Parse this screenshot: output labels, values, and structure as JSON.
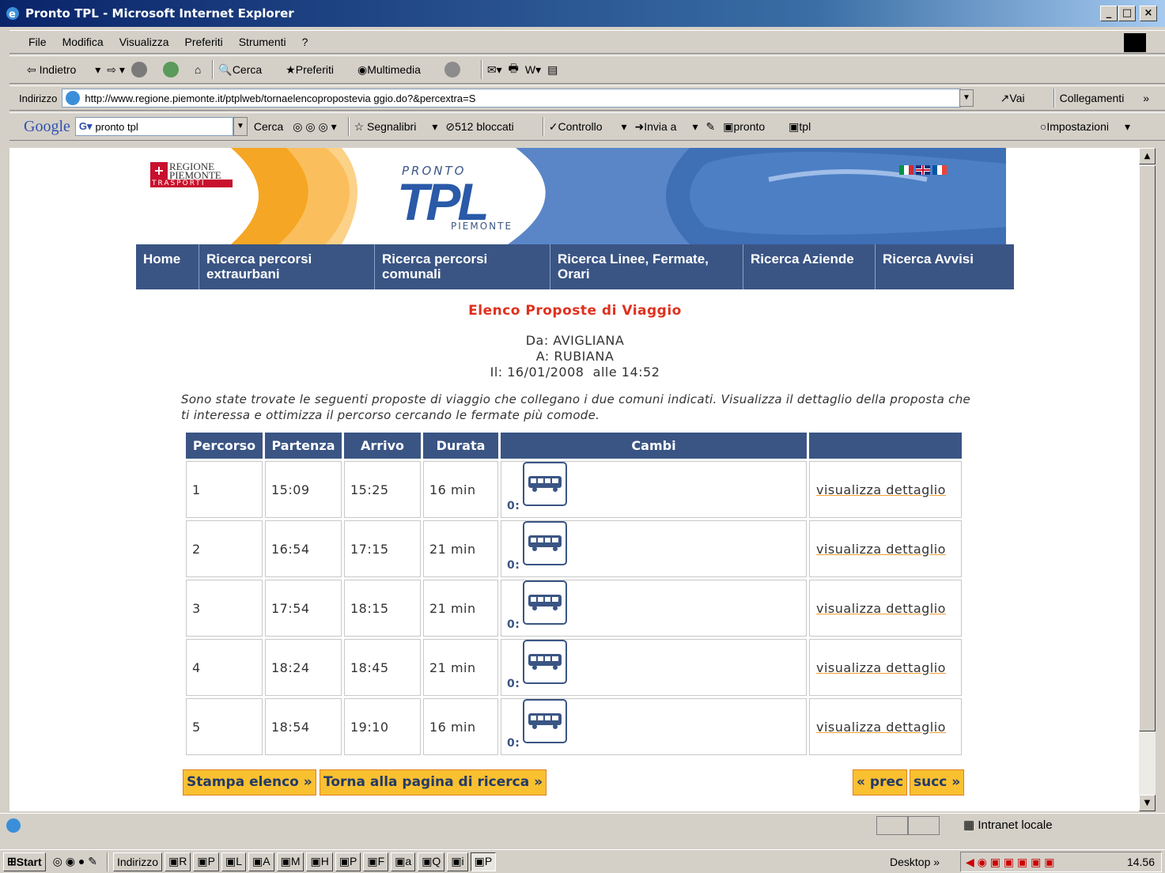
{
  "window": {
    "title": "Pronto TPL - Microsoft Internet Explorer"
  },
  "menu": [
    "File",
    "Modifica",
    "Visualizza",
    "Preferiti",
    "Strumenti",
    "?"
  ],
  "toolbar": {
    "back": "Indietro",
    "search": "Cerca",
    "favorites": "Preferiti",
    "media": "Multimedia"
  },
  "address": {
    "label": "Indirizzo",
    "url": "http://www.regione.piemonte.it/ptplweb/tornaelencopropostevia ggio.do?&percextra=S",
    "go": "Vai",
    "links": "Collegamenti"
  },
  "google": {
    "query": "pronto tpl",
    "search": "Cerca",
    "bookmarks": "Segnalibri",
    "blocked": "512 bloccati",
    "check": "Controllo",
    "send": "Invia a",
    "h1": "pronto",
    "h2": "tpl",
    "settings": "Impostazioni"
  },
  "banner": {
    "region_line1": "REGIONE",
    "region_line2": "PIEMONTE",
    "region_line3": "TRASPORTI",
    "pronto": "PRONTO",
    "tpl": "TPL",
    "piemonte": "PIEMONTE"
  },
  "nav": [
    "Home",
    "Ricerca percorsi extraurbani",
    "Ricerca percorsi comunali",
    "Ricerca Linee, Fermate, Orari",
    "Ricerca Aziende",
    "Ricerca Avvisi"
  ],
  "page": {
    "title": "Elenco Proposte di Viaggio",
    "from": "Da: AVIGLIANA",
    "to": "A: RUBIANA",
    "when": "Il: 16/01/2008  alle 14:52",
    "intro": "Sono state trovate le seguenti proposte di viaggio che collegano i due comuni indicati. Visualizza il dettaglio della proposta che ti interessa e ottimizza il percorso cercando le fermate più comode."
  },
  "table": {
    "headers": [
      "Percorso",
      "Partenza",
      "Arrivo",
      "Durata",
      "Cambi",
      ""
    ],
    "rows": [
      {
        "n": "1",
        "dep": "15:09",
        "arr": "15:25",
        "dur": "16 min",
        "cambi": "0:",
        "link": "visualizza dettaglio"
      },
      {
        "n": "2",
        "dep": "16:54",
        "arr": "17:15",
        "dur": "21 min",
        "cambi": "0:",
        "link": "visualizza dettaglio"
      },
      {
        "n": "3",
        "dep": "17:54",
        "arr": "18:15",
        "dur": "21 min",
        "cambi": "0:",
        "link": "visualizza dettaglio"
      },
      {
        "n": "4",
        "dep": "18:24",
        "arr": "18:45",
        "dur": "21 min",
        "cambi": "0:",
        "link": "visualizza dettaglio"
      },
      {
        "n": "5",
        "dep": "18:54",
        "arr": "19:10",
        "dur": "16 min",
        "cambi": "0:",
        "link": "visualizza dettaglio"
      }
    ]
  },
  "buttons": {
    "print": "Stampa elenco »",
    "back": "Torna alla pagina di ricerca »",
    "prev": "« prec",
    "next": "succ »"
  },
  "status": {
    "zone": "Intranet locale"
  },
  "taskbar": {
    "start": "Start",
    "address": "Indirizzo",
    "desktop": "Desktop",
    "clock": "14.56"
  }
}
